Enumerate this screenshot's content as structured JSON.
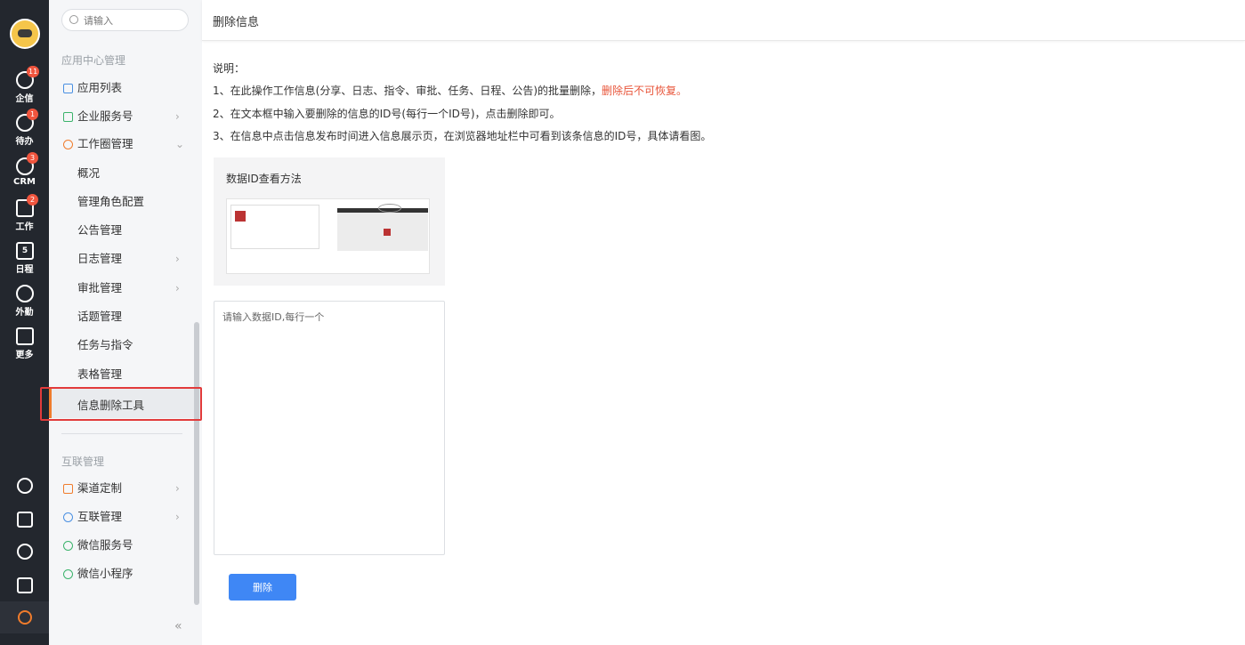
{
  "rail": {
    "items": [
      {
        "label": "企信",
        "badge": "11"
      },
      {
        "label": "待办",
        "badge": "1"
      },
      {
        "label": "CRM",
        "badge": "3"
      },
      {
        "label": "工作",
        "badge": "2"
      },
      {
        "label": "日程",
        "badge": ""
      },
      {
        "label": "外勤",
        "badge": ""
      },
      {
        "label": "更多",
        "badge": ""
      }
    ],
    "calendar_day": "5"
  },
  "sidebar": {
    "search_placeholder": "请输入",
    "group1_title": "应用中心管理",
    "items": [
      {
        "label": "应用列表",
        "arrow": ""
      },
      {
        "label": "企业服务号",
        "arrow": "›"
      },
      {
        "label": "工作圈管理",
        "arrow": "⌄"
      },
      {
        "label": "概况",
        "arrow": ""
      },
      {
        "label": "管理角色配置",
        "arrow": ""
      },
      {
        "label": "公告管理",
        "arrow": ""
      },
      {
        "label": "日志管理",
        "arrow": "›"
      },
      {
        "label": "审批管理",
        "arrow": "›"
      },
      {
        "label": "话题管理",
        "arrow": ""
      },
      {
        "label": "任务与指令",
        "arrow": ""
      },
      {
        "label": "表格管理",
        "arrow": ""
      },
      {
        "label": "信息删除工具",
        "arrow": ""
      }
    ],
    "group2_title": "互联管理",
    "items2": [
      {
        "label": "渠道定制",
        "arrow": "›"
      },
      {
        "label": "互联管理",
        "arrow": "›"
      },
      {
        "label": "微信服务号",
        "arrow": ""
      },
      {
        "label": "微信小程序",
        "arrow": ""
      }
    ],
    "collapse_label": "«"
  },
  "header": {
    "title": "删除信息"
  },
  "main": {
    "note_title": "说明：",
    "note1": "1、在此操作工作信息(分享、日志、指令、审批、任务、日程、公告)的批量删除，",
    "note1_warn": "删除后不可恢复。",
    "note2": "2、在文本框中输入要删除的信息的ID号(每行一个ID号)，点击删除即可。",
    "note3": "3、在信息中点击信息发布时间进入信息展示页，在浏览器地址栏中可看到该条信息的ID号，具体请看图。",
    "card_title": "数据ID查看方法",
    "input_placeholder": "请输入数据ID,每行一个",
    "delete_label": "删除"
  },
  "colors": {
    "accent": "#3f87f5",
    "warn": "#e8553a",
    "rail_bg": "#23272e",
    "active": "#f07c2c"
  }
}
